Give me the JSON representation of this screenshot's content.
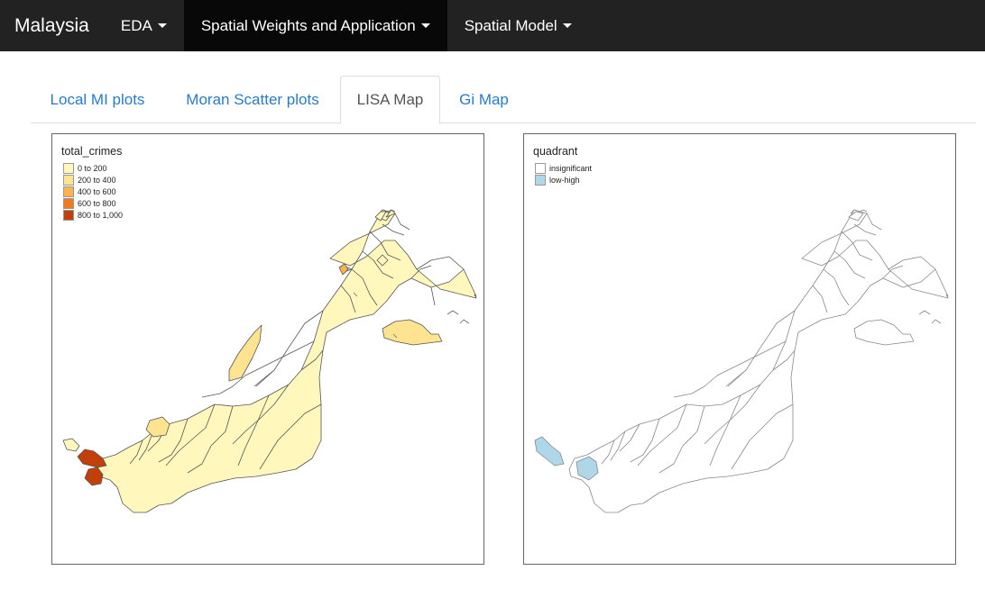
{
  "navbar": {
    "brand": "Malaysia",
    "items": [
      {
        "label": "EDA"
      },
      {
        "label": "Spatial Weights and Application"
      },
      {
        "label": "Spatial Model"
      }
    ]
  },
  "tabs": [
    {
      "label": "Local MI plots"
    },
    {
      "label": "Moran Scatter plots"
    },
    {
      "label": "LISA Map"
    },
    {
      "label": "Gi Map"
    }
  ],
  "left_map": {
    "legend_title": "total_crimes",
    "legend": [
      {
        "label": "0 to 200",
        "color": "#fff7bc"
      },
      {
        "label": "200 to 400",
        "color": "#fee391"
      },
      {
        "label": "400 to 600",
        "color": "#fdb24d"
      },
      {
        "label": "600 to 800",
        "color": "#f17b1c"
      },
      {
        "label": "800 to 1,000",
        "color": "#c13f08"
      }
    ]
  },
  "right_map": {
    "legend_title": "quadrant",
    "legend": [
      {
        "label": "insignificant",
        "color": "#ffffff"
      },
      {
        "label": "low-high",
        "color": "#aed7ea"
      }
    ]
  },
  "colors": {
    "navbar_bg": "#222222",
    "navbar_active": "#080808",
    "tab_link": "#2a7ac9"
  }
}
